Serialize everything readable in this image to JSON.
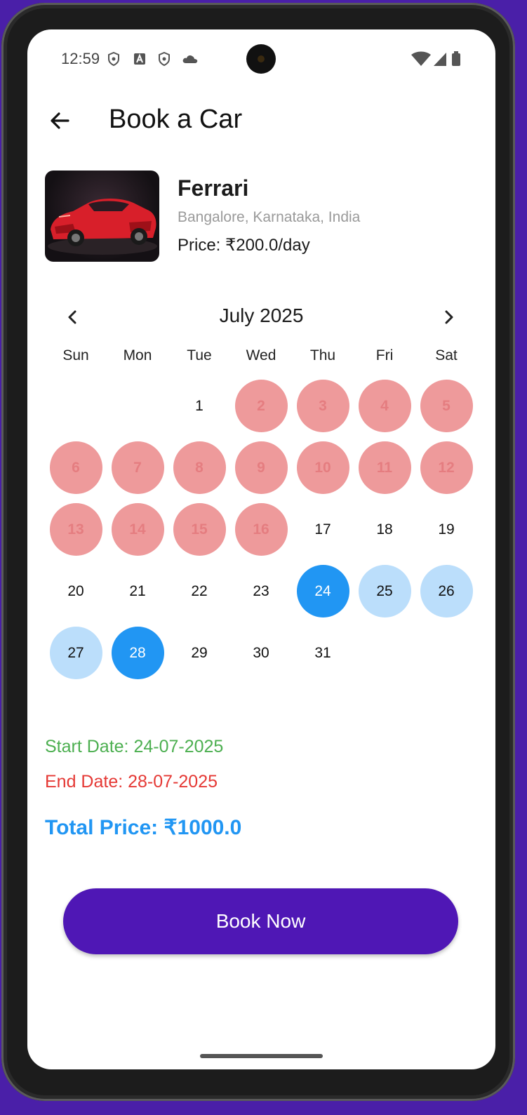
{
  "status_bar": {
    "time": "12:59"
  },
  "app_bar": {
    "title": "Book a Car"
  },
  "car": {
    "name": "Ferrari",
    "location": "Bangalore, Karnataka, India",
    "price": "Price: ₹200.0/day"
  },
  "calendar": {
    "month_label": "July 2025",
    "weekdays": [
      "Sun",
      "Mon",
      "Tue",
      "Wed",
      "Thu",
      "Fri",
      "Sat"
    ],
    "first_weekday_index": 2,
    "days_in_month": 31,
    "booked_days": [
      2,
      3,
      4,
      5,
      6,
      7,
      8,
      9,
      10,
      11,
      12,
      13,
      14,
      15,
      16
    ],
    "selected_start": 24,
    "selected_end": 28,
    "colors": {
      "booked": "#ee9a9b",
      "selected": "#2196f3",
      "in_range": "#bbdefb"
    }
  },
  "summary": {
    "start_date": "Start Date: 24-07-2025",
    "end_date": "End Date: 28-07-2025",
    "total_price": "Total Price: ₹1000.0",
    "colors": {
      "start": "#4caf50",
      "end": "#e53935",
      "total": "#2196f3"
    }
  },
  "actions": {
    "book_label": "Book Now",
    "button_color": "#4f17b5"
  }
}
